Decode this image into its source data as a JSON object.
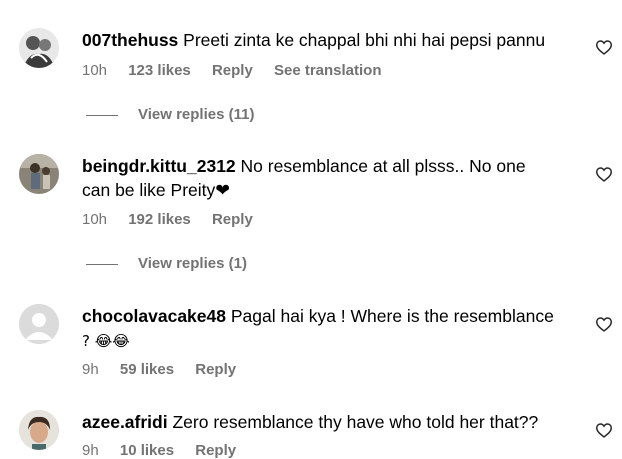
{
  "comments": [
    {
      "username": "007thehuss",
      "text": "Preeti zinta ke chappal bhi nhi hai pepsi pannu",
      "text2": "",
      "time": "10h",
      "likes": "123 likes",
      "reply": "Reply",
      "translate": "See translation",
      "view_replies": "View replies (11)"
    },
    {
      "username": "beingdr.kittu_2312",
      "text": "No resemblance at all plsss.. No one",
      "text2": "can be like Preity❤",
      "time": "10h",
      "likes": "192 likes",
      "reply": "Reply",
      "view_replies": "View replies (1)"
    },
    {
      "username": "chocolavacake48",
      "text": "Pagal hai kya ! Where is the resemblance",
      "text2": "? 😂😂",
      "time": "9h",
      "likes": "59 likes",
      "reply": "Reply"
    },
    {
      "username": "azee.afridi",
      "text": "Zero resemblance thy have who told her that??",
      "text2": "",
      "time": "9h",
      "likes": "10 likes",
      "reply": "Reply"
    }
  ],
  "icons": {
    "heart": "heart-outline-icon",
    "avatar_placeholder": "default-avatar-icon"
  },
  "colors": {
    "text": "#000000",
    "meta": "#737373",
    "avatar_placeholder": "#d9d9d9"
  }
}
